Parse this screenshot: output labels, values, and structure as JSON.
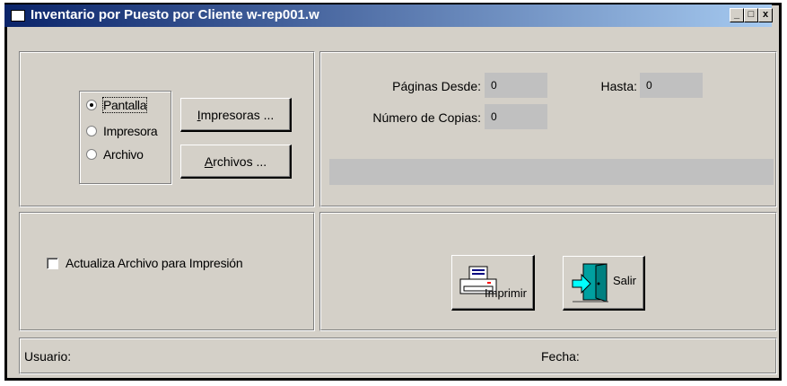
{
  "window": {
    "title": "Inventario por Puesto por Cliente w-rep001.w",
    "controls": {
      "minimize": "_",
      "maximize": "□",
      "close": "x"
    }
  },
  "output": {
    "options": [
      {
        "label": "Pantalla",
        "selected": true
      },
      {
        "label": "Impresora",
        "selected": false
      },
      {
        "label": "Archivo",
        "selected": false
      }
    ],
    "impresoras_button": {
      "mnemonic": "I",
      "rest": "mpresoras ..."
    },
    "archivos_button": {
      "mnemonic": "A",
      "rest": "rchivos ..."
    }
  },
  "pages": {
    "desde_label": "Páginas Desde:",
    "desde_value": "0",
    "hasta_label": "Hasta:",
    "hasta_value": "0",
    "copias_label": "Número de Copias:",
    "copias_value": "0"
  },
  "options": {
    "actualiza_label": "Actualiza Archivo para Impresión",
    "actualiza_checked": false
  },
  "actions": {
    "imprimir_mnemonic": "I",
    "imprimir_rest": "mprimir",
    "salir_label": "Salir",
    "printer_icon": "printer-icon",
    "exit_icon": "exit-door-icon"
  },
  "status": {
    "usuario_label": "Usuario:",
    "fecha_label": "Fecha:"
  }
}
